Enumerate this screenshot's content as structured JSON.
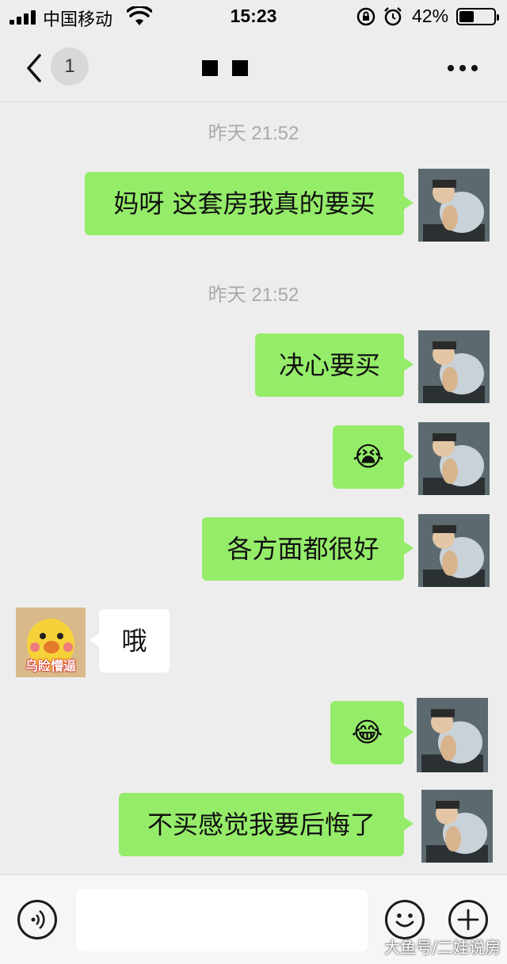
{
  "status_bar": {
    "carrier": "中国移动",
    "time": "15:23",
    "battery": "42%",
    "battery_level": 0.42
  },
  "nav": {
    "badge": "1",
    "title_hidden_chars": 2
  },
  "chat": {
    "timestamps": [
      "昨天 21:52",
      "昨天 21:52"
    ],
    "messages": [
      {
        "from": "me",
        "text": "妈呀 这套房我真的要买"
      },
      {
        "from": "me",
        "text": "决心要买"
      },
      {
        "from": "me",
        "text": "😭",
        "emoji": "crying-face-emoji"
      },
      {
        "from": "me",
        "text": "各方面都很好"
      },
      {
        "from": "them",
        "text": "哦"
      },
      {
        "from": "me",
        "text": "😂",
        "emoji": "tears-of-joy-emoji"
      },
      {
        "from": "me",
        "text": "不买感觉我要后悔了"
      }
    ],
    "contact_avatar_caption": "乌睑懵逼"
  },
  "footer": {
    "watermark": "大鱼号/二娃说房"
  },
  "colors": {
    "bubble_me": "#95ec69",
    "bubble_them": "#ffffff",
    "background": "#ededed"
  }
}
